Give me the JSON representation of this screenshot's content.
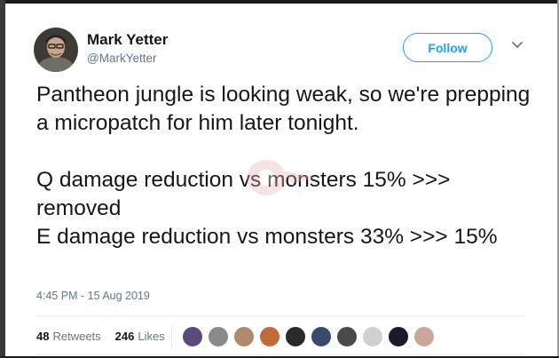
{
  "user": {
    "display_name": "Mark Yetter",
    "handle": "@MarkYetter"
  },
  "follow_label": "Follow",
  "tweet": {
    "lines": [
      "Pantheon jungle is looking weak, so we're prepping a micropatch for him later tonight.",
      "",
      "Q damage reduction vs monsters 15% >>> removed",
      "E damage reduction vs monsters 33% >>> 15%"
    ],
    "timestamp": "4:45 PM - 15 Aug 2019"
  },
  "stats": {
    "retweets_count": "48",
    "retweets_label": "Retweets",
    "likes_count": "246",
    "likes_label": "Likes"
  },
  "likers": [
    {
      "name": "liker-avatar-1",
      "color": "#5b4a7a"
    },
    {
      "name": "liker-avatar-2",
      "color": "#8a8a8a"
    },
    {
      "name": "liker-avatar-3",
      "color": "#b08a6a"
    },
    {
      "name": "liker-avatar-4",
      "color": "#c06a3a"
    },
    {
      "name": "liker-avatar-5",
      "color": "#2a2a2a"
    },
    {
      "name": "liker-avatar-6",
      "color": "#3a4a6a"
    },
    {
      "name": "liker-avatar-7",
      "color": "#4a4a4a"
    },
    {
      "name": "liker-avatar-8",
      "color": "#d0d0d0"
    },
    {
      "name": "liker-avatar-9",
      "color": "#1a1a2a"
    },
    {
      "name": "liker-avatar-10",
      "color": "#c8a898"
    }
  ],
  "colors": {
    "accent": "#1da1f2",
    "text": "#14171a",
    "secondary": "#657786"
  }
}
